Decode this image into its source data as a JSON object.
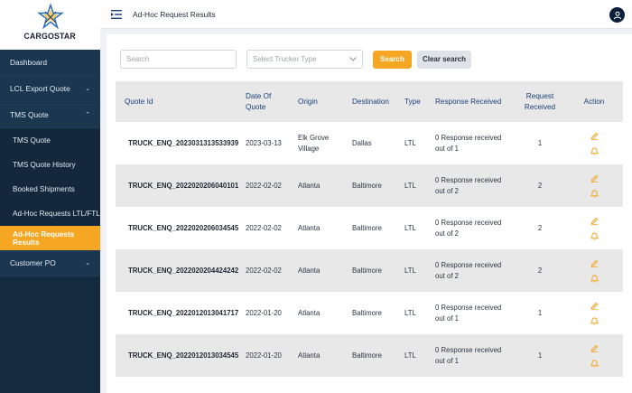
{
  "brand": {
    "name": "CARGOSTAR"
  },
  "sidebar": {
    "items": [
      {
        "label": "Dashboard"
      },
      {
        "label": "LCL Export Quote"
      },
      {
        "label": "TMS Quote"
      },
      {
        "label": "TMS Quote"
      },
      {
        "label": "TMS Quote History"
      },
      {
        "label": "Booked Shipments"
      },
      {
        "label": "Ad-Hoc Requests LTL/FTL"
      },
      {
        "label": "Ad-Hoc Requests Results"
      },
      {
        "label": "Customer PO"
      }
    ]
  },
  "header": {
    "title": "Ad-Hoc Request Results"
  },
  "filters": {
    "search_placeholder": "Search",
    "trucker_type_placeholder": "Select Trucker Type",
    "search_button": "Search",
    "clear_button": "Clear search"
  },
  "table": {
    "columns": [
      "Quote Id",
      "Date Of Quote",
      "Origin",
      "Destination",
      "Type",
      "Response Received",
      "Request Received",
      "Action"
    ],
    "rows": [
      {
        "quote_id": "TRUCK_ENQ_2023031313533939",
        "date": "2023-03-13",
        "origin": "Elk Grove Village",
        "destination": "Dallas",
        "type": "LTL",
        "response": "0 Response received out of 1",
        "requests": "1"
      },
      {
        "quote_id": "TRUCK_ENQ_2022020206040101",
        "date": "2022-02-02",
        "origin": "Atlanta",
        "destination": "Baltimore",
        "type": "LTL",
        "response": "0 Response received out of 2",
        "requests": "2"
      },
      {
        "quote_id": "TRUCK_ENQ_2022020206034545",
        "date": "2022-02-02",
        "origin": "Atlanta",
        "destination": "Baltimore",
        "type": "LTL",
        "response": "0 Response received out of 2",
        "requests": "2"
      },
      {
        "quote_id": "TRUCK_ENQ_2022020204424242",
        "date": "2022-02-02",
        "origin": "Atlanta",
        "destination": "Baltimore",
        "type": "LTL",
        "response": "0 Response received out of 2",
        "requests": "2"
      },
      {
        "quote_id": "TRUCK_ENQ_2022012013041717",
        "date": "2022-01-20",
        "origin": "Atlanta",
        "destination": "Baltimore",
        "type": "LTL",
        "response": "0 Response received out of 1",
        "requests": "1"
      },
      {
        "quote_id": "TRUCK_ENQ_2022012013034545",
        "date": "2022-01-20",
        "origin": "Atlanta",
        "destination": "Baltimore",
        "type": "LTL",
        "response": "0 Response received out of 1",
        "requests": "1"
      }
    ]
  },
  "icons": {
    "edit": "pencil-icon",
    "notify": "bell-icon",
    "menu": "menu-collapse-icon",
    "user": "user-icon",
    "dropdown": "chevron-down-icon"
  },
  "colors": {
    "sidebar_bg": "#142a3e",
    "accent": "#f5a623",
    "header_text": "#1b3f7a",
    "row_alt": "#e8e8e8"
  }
}
